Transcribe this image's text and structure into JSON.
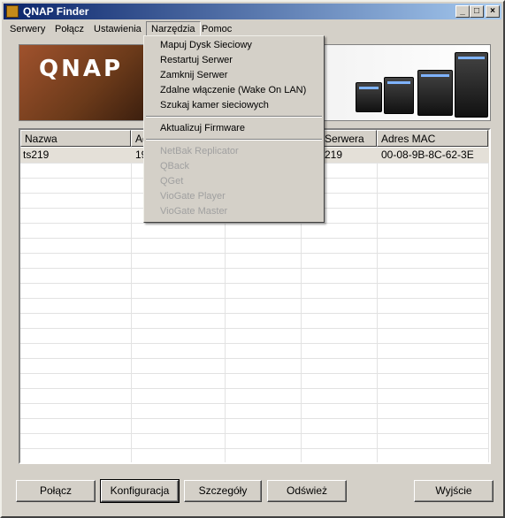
{
  "window": {
    "title": "QNAP Finder"
  },
  "titlebar_buttons": {
    "minimize": "_",
    "maximize": "□",
    "close": "×"
  },
  "menubar": {
    "items": [
      {
        "label": "Serwery"
      },
      {
        "label": "Połącz"
      },
      {
        "label": "Ustawienia"
      },
      {
        "label": "Narzędzia"
      },
      {
        "label": "Pomoc"
      }
    ]
  },
  "banner": {
    "logo": "QNAP"
  },
  "dropdown": {
    "items": [
      {
        "label": "Mapuj Dysk Sieciowy"
      },
      {
        "label": "Restartuj Serwer"
      },
      {
        "label": "Zamknij Serwer"
      },
      {
        "label": "Zdalne włączenie (Wake On LAN)"
      },
      {
        "label": "Szukaj kamer sieciowych"
      },
      {
        "label": "Aktualizuj Firmware"
      },
      {
        "label": "NetBak Replicator"
      },
      {
        "label": "QBack"
      },
      {
        "label": "QGet"
      },
      {
        "label": "VioGate Player"
      },
      {
        "label": "VioGate Master"
      }
    ]
  },
  "table": {
    "columns": [
      "Nazwa",
      "Ad",
      "Serwera",
      "Adres MAC"
    ],
    "rows": [
      {
        "name": "ts219",
        "address": "19",
        "server": "219",
        "mac": "00-08-9B-8C-62-3E"
      }
    ]
  },
  "buttons": {
    "connect": "Połącz",
    "config": "Konfiguracja",
    "details": "Szczegóły",
    "refresh": "Odśwież",
    "exit": "Wyjście"
  },
  "colors": {
    "titlebar_start": "#0a246a",
    "titlebar_end": "#a6caf0",
    "face": "#d4d0c8"
  }
}
